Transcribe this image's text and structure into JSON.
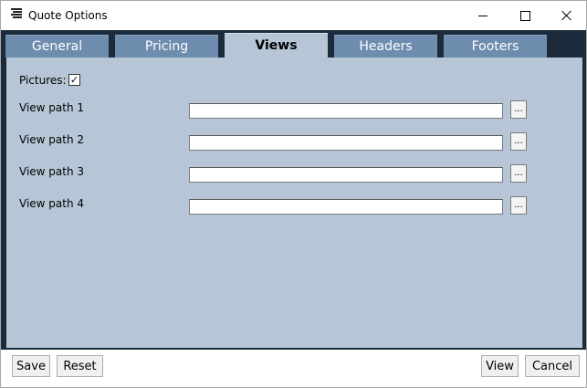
{
  "window": {
    "title": "Quote Options",
    "app_icon": "list-icon",
    "controls": [
      "minimize-icon",
      "maximize-icon",
      "close-icon"
    ]
  },
  "tabs": [
    {
      "label": "General",
      "active": false
    },
    {
      "label": "Pricing",
      "active": false
    },
    {
      "label": "Views",
      "active": true
    },
    {
      "label": "Headers",
      "active": false
    },
    {
      "label": "Footers",
      "active": false
    }
  ],
  "views": {
    "pictures_label": "Pictures:",
    "pictures_checked": true,
    "check_glyph": "✓",
    "paths": [
      {
        "label": "View path 1",
        "value": "",
        "browse_label": "..."
      },
      {
        "label": "View path 2",
        "value": "",
        "browse_label": "..."
      },
      {
        "label": "View path 3",
        "value": "",
        "browse_label": "..."
      },
      {
        "label": "View path 4",
        "value": "",
        "browse_label": "..."
      }
    ]
  },
  "footer": {
    "save_label": "Save",
    "reset_label": "Reset",
    "view_label": "View",
    "cancel_label": "Cancel"
  },
  "colors": {
    "tab_strip": "#1b2b3c",
    "tab_inactive": "#6e8cae",
    "panel": "#b6c6d6"
  }
}
